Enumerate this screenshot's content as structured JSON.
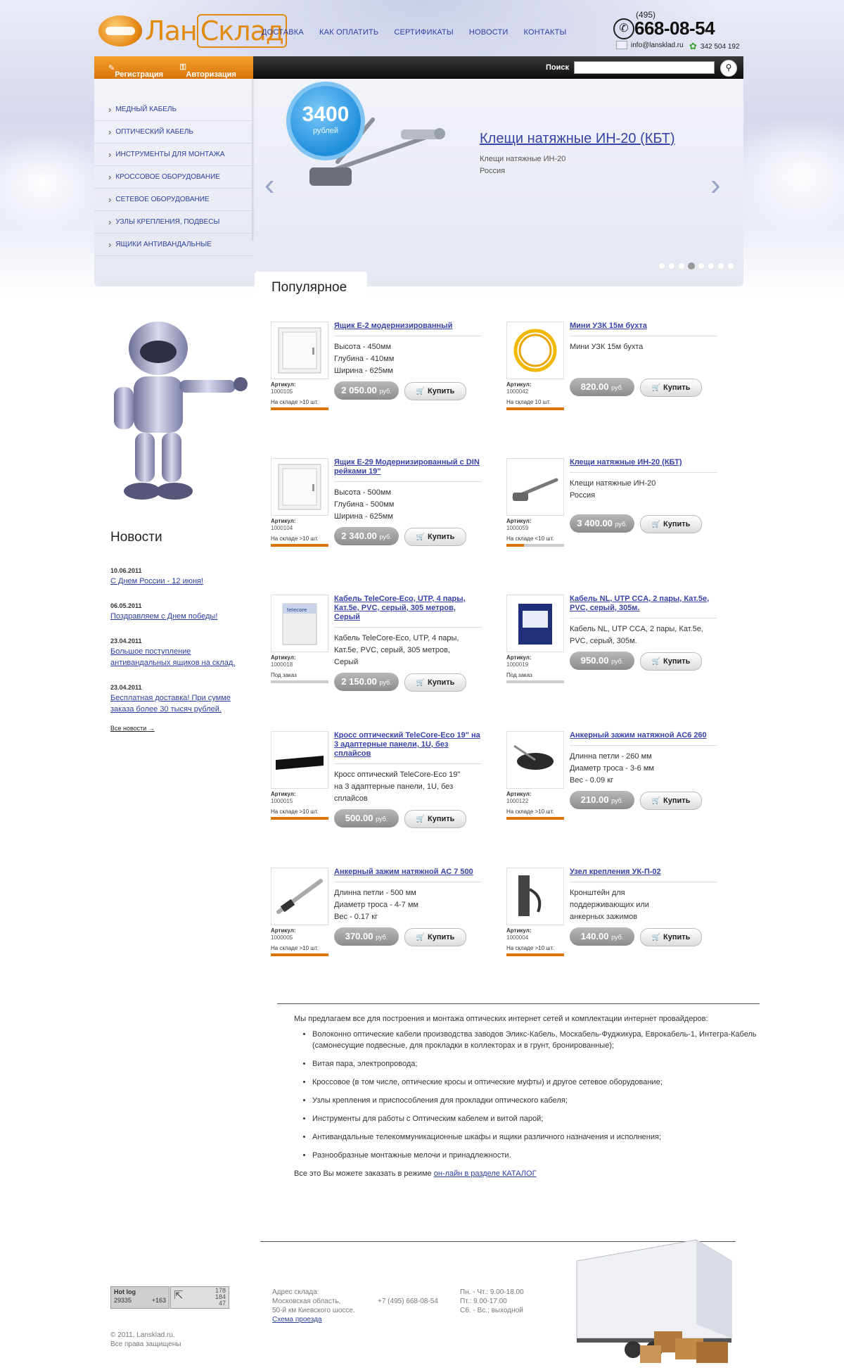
{
  "brand": {
    "logo_left": "Лан",
    "logo_right": "Склад"
  },
  "topnav": [
    "ДОСТАВКА",
    "КАК ОПЛАТИТЬ",
    "СЕРТИФИКАТЫ",
    "НОВОСТИ",
    "КОНТАКТЫ"
  ],
  "contacts": {
    "phone_code": "(495)",
    "phone": "668-08-54",
    "email": "info@lansklad.ru",
    "icq": "342 504 192"
  },
  "auth": {
    "register": "Регистрация",
    "login": "Авторизация"
  },
  "search": {
    "label": "Поиск",
    "value": ""
  },
  "catalog": [
    "МЕДНЫЙ КАБЕЛЬ",
    "ОПТИЧЕСКИЙ КАБЕЛЬ",
    "ИНСТРУМЕНТЫ ДЛЯ МОНТАЖА",
    "КРОССОВОЕ ОБОРУДОВАНИЕ",
    "СЕТЕВОЕ ОБОРУДОВАНИЕ",
    "УЗЛЫ КРЕПЛЕНИЯ, ПОДВЕСЫ",
    "ЯЩИКИ АНТИВАНДАЛЬНЫЕ"
  ],
  "slider": {
    "price": "3400",
    "currency": "рублей",
    "title": "Клещи натяжные ИН-20 (КБТ)",
    "sub1": "Клещи натяжные ИН-20",
    "sub2": "Россия",
    "dots_total": 8,
    "dots_active": 3
  },
  "popular": {
    "title": "Популярное"
  },
  "news": {
    "title": "Новости",
    "items": [
      {
        "date": "10.06.2011",
        "text": "С Днем России - 12 июня!"
      },
      {
        "date": "06.05.2011",
        "text": "Поздравляем с Днем победы!"
      },
      {
        "date": "23.04.2011",
        "text": "Большое поступление антивандальных ящиков на склад."
      },
      {
        "date": "23.04.2011",
        "text": "Бесплатная доставка! При сумме заказа более 30 тысяч рублей."
      }
    ],
    "all": "Все новости"
  },
  "products": [
    {
      "name": "Ящик E-2 модернизированный",
      "desc": [
        "Высота - 450мм",
        "Глубина - 410мм",
        "Ширина - 625мм"
      ],
      "art_label": "Артикул:",
      "art": "1000105",
      "stock": "На складе >10 шт.",
      "stock_level": 1,
      "price": "2 050.00",
      "cur": "руб.",
      "buy": "Купить",
      "img": "cabinet"
    },
    {
      "name": "Мини УЗК 15м бухта",
      "desc": [
        "Мини УЗК 15м бухта"
      ],
      "art_label": "Артикул:",
      "art": "1000042",
      "stock": "На складе 10 шт.",
      "stock_level": 1,
      "price": "820.00",
      "cur": "руб.",
      "buy": "Купить",
      "img": "coil"
    },
    {
      "name": "Ящик E-29 Модернизированный с DIN рейками 19\"",
      "desc": [
        "Высота - 500мм",
        "Глубина - 500мм",
        "Ширина - 625мм"
      ],
      "art_label": "Артикул:",
      "art": "1000104",
      "stock": "На складе >10 шт.",
      "stock_level": 1,
      "price": "2 340.00",
      "cur": "руб.",
      "buy": "Купить",
      "img": "cabinet"
    },
    {
      "name": "Клещи натяжные ИН-20 (КБТ)",
      "desc": [
        "Клещи натяжные ИН-20",
        "Россия"
      ],
      "art_label": "Артикул:",
      "art": "1000059",
      "stock": "На складе <10 шт.",
      "stock_level": 0.3,
      "price": "3 400.00",
      "cur": "руб.",
      "buy": "Купить",
      "img": "tool"
    },
    {
      "name": "Кабель TeleCore-Eco, UTP, 4 пары, Кат.5е, PVC, серый, 305 метров, Серый",
      "desc": [
        "Кабель TeleCore-Eco, UTP, 4 пары,",
        "Кат.5е, PVC, серый, 305 метров,",
        "Серый"
      ],
      "art_label": "Артикул:",
      "art": "1000018",
      "stock": "Под заказ",
      "stock_level": 0,
      "price": "2 150.00",
      "cur": "руб.",
      "buy": "Купить",
      "img": "box"
    },
    {
      "name": "Кабель NL, UTP CCA, 2 пары, Кат.5е, PVC, серый, 305м.",
      "desc": [
        "Кабель NL, UTP CCA, 2 пары, Кат.5е,",
        "PVC, серый, 305м."
      ],
      "art_label": "Артикул:",
      "art": "1000019",
      "stock": "Под заказ",
      "stock_level": 0,
      "price": "950.00",
      "cur": "руб.",
      "buy": "Купить",
      "img": "box2"
    },
    {
      "name": "Кросс оптический TeleCore-Eco 19\" на 3 адаптерные панели, 1U, без сплайсов",
      "desc": [
        "Кросс оптический TeleCore-Eco 19\"",
        "на  3 адаптерные панели, 1U, без",
        "сплайсов"
      ],
      "art_label": "Артикул:",
      "art": "1000015",
      "stock": "На складе >10 шт.",
      "stock_level": 1,
      "price": "500.00",
      "cur": "руб.",
      "buy": "Купить",
      "img": "panel"
    },
    {
      "name": "Анкерный зажим натяжной АС6 260",
      "desc": [
        "Длинна петли - 260 мм",
        "Диаметр троса - 3-6 мм",
        "Вес - 0.09 кг"
      ],
      "art_label": "Артикул:",
      "art": "1000122",
      "stock": "На складе >10 шт.",
      "stock_level": 1,
      "price": "210.00",
      "cur": "руб.",
      "buy": "Купить",
      "img": "clamp"
    },
    {
      "name": "Анкерный зажим натяжной АС 7 500",
      "desc": [
        "Длинна петли - 500 мм",
        "Диаметр троса - 4-7 мм",
        "Вес - 0.17 кг"
      ],
      "art_label": "Артикул:",
      "art": "1000005",
      "stock": "На складе >10 шт.",
      "stock_level": 1,
      "price": "370.00",
      "cur": "руб.",
      "buy": "Купить",
      "img": "clamp2"
    },
    {
      "name": "Узел крепления УК-П-02",
      "desc": [
        "Кронштейн для",
        "поддерживающих или",
        "анкерных зажимов"
      ],
      "art_label": "Артикул:",
      "art": "1000004",
      "stock": "На складе >10 шт.",
      "stock_level": 1,
      "price": "140.00",
      "cur": "руб.",
      "buy": "Купить",
      "img": "bracket"
    }
  ],
  "info": {
    "intro": "Мы предлагаем все для построения и монтажа оптических интернет сетей и комплектации интернет провайдеров:",
    "items": [
      "Волоконно оптические кабели производства заводов Эликс-Кабель, Москабель-Фуджикура, Еврокабель-1, Интегра-Кабель (самонесущие подвесные, для прокладки в коллекторах и в грунт, бронированные);",
      "Витая пара, электропровода;",
      "Кроссовое (в том числе, оптические кросы и оптические муфты) и другое сетевое оборудование;",
      "Узлы крепления и приспособления для прокладки оптического кабеля;",
      "Инструменты для работы с Оптическим кабелем и витой парой;",
      "Антивандальные телекоммуникационные шкафы и ящики различного назначения и исполнения;",
      "Разнообразные монтажные мелочи и принадлежности."
    ],
    "outro_prefix": "Все это Вы можете заказать в режиме ",
    "outro_link": "он-лайн в разделе КАТАЛОГ"
  },
  "footer": {
    "counter1_title": "Hot log",
    "counter1_a": "29335",
    "counter1_b": "+163",
    "counter2_a": "178",
    "counter2_b": "184",
    "counter2_c": "47",
    "copyright": "© 2011, Lansklad.ru.",
    "rights": "Все права защищены",
    "address_title": "Адрес склада:",
    "address_1": "Московская область,",
    "address_2": "50-й км Киевского шоссе.",
    "scheme": "Схема проезда",
    "phone": "+7 (495) 668-08-54",
    "hours_1": "Пн. - Чт.: 9.00-18.00",
    "hours_2": "Пт.: 9.00-17.00",
    "hours_3": "Сб. - Вс.: выходной"
  },
  "colors": {
    "accent": "#d9740b",
    "link": "#2b3fa0",
    "dark_bar": "#0d0d0d"
  }
}
